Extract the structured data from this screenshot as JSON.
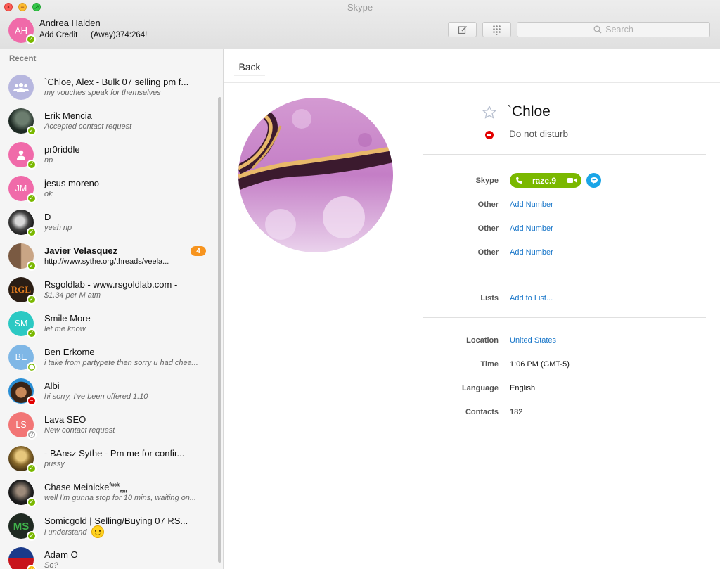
{
  "window": {
    "title": "Skype"
  },
  "me": {
    "initials": "AH",
    "name": "Andrea Halden",
    "credit_label": "Add Credit",
    "status_text": "(Away)374:264!"
  },
  "toolbar": {
    "search_placeholder": "Search"
  },
  "sidebar": {
    "heading": "Recent",
    "conversations": [
      {
        "name": "`Chloe, Alex - Bulk 07 selling pm f...",
        "message": "my vouches speak for themselves",
        "avatar": "group-icon",
        "status": "none"
      },
      {
        "name": "Erik Mencia",
        "message": "Accepted contact request",
        "avatar": "photo",
        "status": "online"
      },
      {
        "name": "pr0riddle",
        "message": "np",
        "avatar": "person-icon",
        "status": "online"
      },
      {
        "name": "jesus moreno",
        "initials": "JM",
        "message": "ok",
        "status": "online"
      },
      {
        "name": "D",
        "message": "yeah np",
        "avatar": "photo",
        "status": "online"
      },
      {
        "name": "Javier Velasquez",
        "message": "http://www.sythe.org/threads/veela...",
        "badge": "4",
        "avatar": "photo",
        "status": "online"
      },
      {
        "name": "Rsgoldlab - www.rsgoldlab.com -",
        "message": "$1.34 per M atm",
        "avatar_text": "RGL",
        "status": "online"
      },
      {
        "name": "Smile More",
        "initials": "SM",
        "message": "let me know",
        "status": "online"
      },
      {
        "name": "Ben Erkome",
        "initials": "BE",
        "message": "i take from partypete then sorry u had chea...",
        "status": "offline"
      },
      {
        "name": "Albi",
        "message": "hi sorry, I've been offered 1.10",
        "avatar": "photo",
        "status": "dnd"
      },
      {
        "name": "Lava SEO",
        "initials": "LS",
        "message": "New contact request",
        "status": "unknown"
      },
      {
        "name": "- BAnsz Sythe - Pm me for confir...",
        "message": "pussy",
        "avatar": "photo",
        "status": "online"
      },
      {
        "name": "Chase Meinicke",
        "name_sup": "fuck",
        "name_sub": "Yall",
        "message": "well I'm gunna stop for 10 mins, waiting on...",
        "avatar": "photo",
        "status": "online"
      },
      {
        "name": "Somicgold  | Selling/Buying 07 RS...",
        "message": "i understand",
        "avatar_text": "MS",
        "status": "online"
      },
      {
        "name": "Adam O",
        "message": "So?",
        "avatar": "photo",
        "status": "away"
      }
    ]
  },
  "main": {
    "back_label": "Back"
  },
  "profile": {
    "name": "`Chloe",
    "status": "Do not disturb",
    "skype_label": "Skype",
    "skype_id": "raze.9",
    "phones": [
      {
        "label": "Other",
        "action": "Add Number"
      },
      {
        "label": "Other",
        "action": "Add Number"
      },
      {
        "label": "Other",
        "action": "Add Number"
      }
    ],
    "lists_label": "Lists",
    "lists_action": "Add to List...",
    "location_label": "Location",
    "location": "United States",
    "time_label": "Time",
    "time": "1:06 PM (GMT-5)",
    "language_label": "Language",
    "language": "English",
    "contacts_label": "Contacts",
    "contacts": "182"
  },
  "colors": {
    "accent_blue": "#1876c9",
    "online_green": "#7ab800",
    "dnd_red": "#e30000",
    "badge_orange": "#f7941e",
    "chat_blue": "#1aa5e7"
  }
}
